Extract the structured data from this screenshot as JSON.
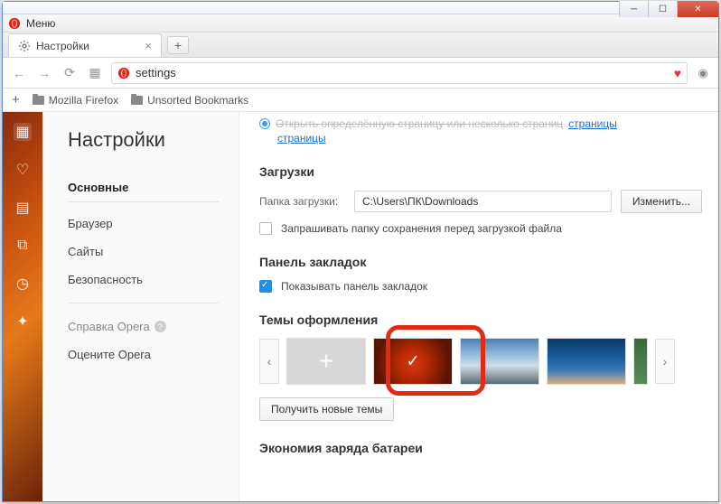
{
  "menu": {
    "label": "Меню"
  },
  "tab": {
    "title": "Настройки"
  },
  "address": {
    "value": "settings"
  },
  "bookmarks": {
    "folder1": "Mozilla Firefox",
    "folder2": "Unsorted Bookmarks"
  },
  "settings": {
    "title": "Настройки",
    "nav": {
      "basic": "Основные",
      "browser": "Браузер",
      "sites": "Сайты",
      "security": "Безопасность",
      "help": "Справка Opera",
      "rate": "Оцените Opera"
    }
  },
  "cutoff": {
    "link": "страницы"
  },
  "downloads": {
    "heading": "Загрузки",
    "folder_label": "Папка загрузки:",
    "folder_value": "C:\\Users\\ПК\\Downloads",
    "change": "Изменить...",
    "ask_before": "Запрашивать папку сохранения перед загрузкой файла"
  },
  "bookmarks_panel": {
    "heading": "Панель закладок",
    "show": "Показывать панель закладок"
  },
  "themes": {
    "heading": "Темы оформления",
    "get_new": "Получить новые темы"
  },
  "battery": {
    "heading": "Экономия заряда батареи"
  }
}
